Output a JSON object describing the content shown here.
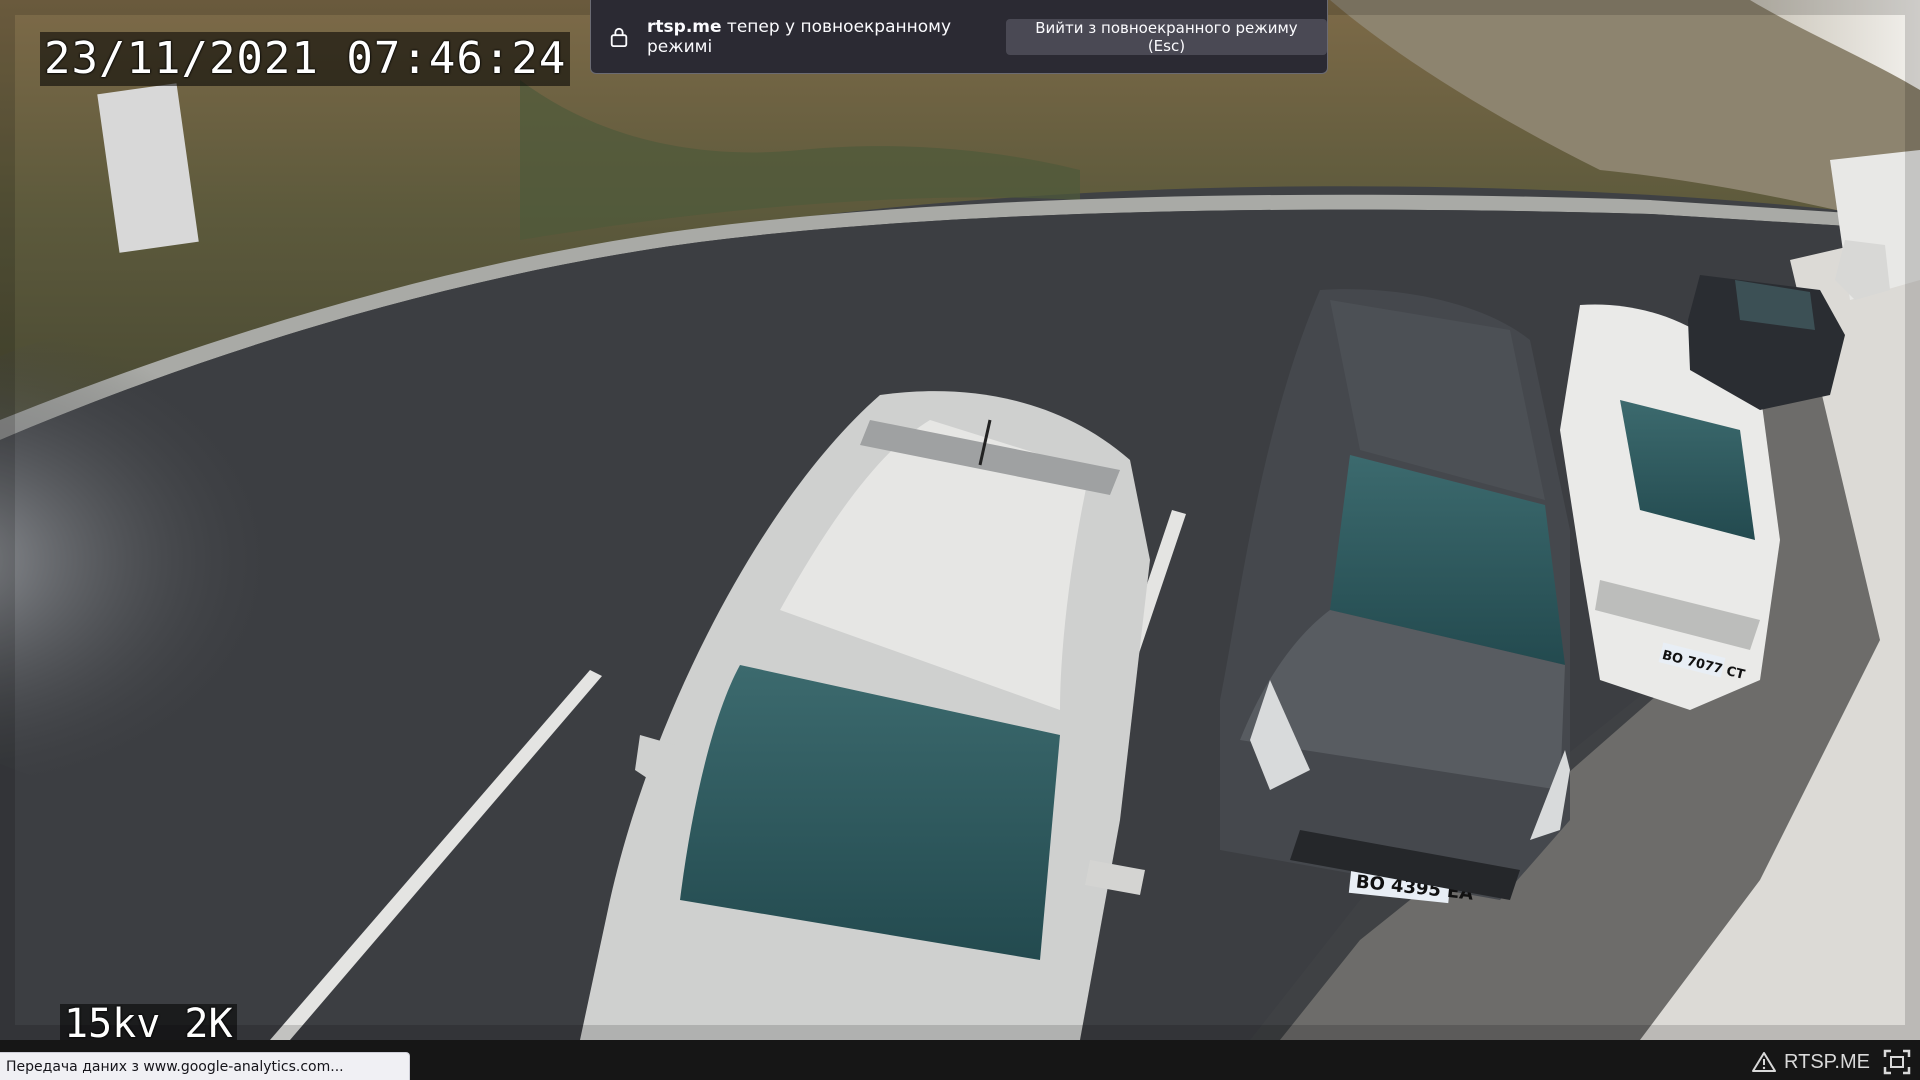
{
  "video": {
    "timestamp": "23/11/2021 07:46:24",
    "label": "15kv 2K",
    "plates": [
      "BO 4395 EA",
      "BO 7077 CT"
    ]
  },
  "fullscreen_notice": {
    "site": "rtsp.me",
    "message": " тепер у повноекранному режимі",
    "exit_label": "Вийти з повноекранного режиму (Esc)"
  },
  "status_bar": {
    "text": "Передача даних з www.google-analytics.com..."
  },
  "player": {
    "brand": "RTSP.ME",
    "icons": [
      "warning-icon",
      "fullscreen-icon",
      "lock-icon"
    ]
  }
}
